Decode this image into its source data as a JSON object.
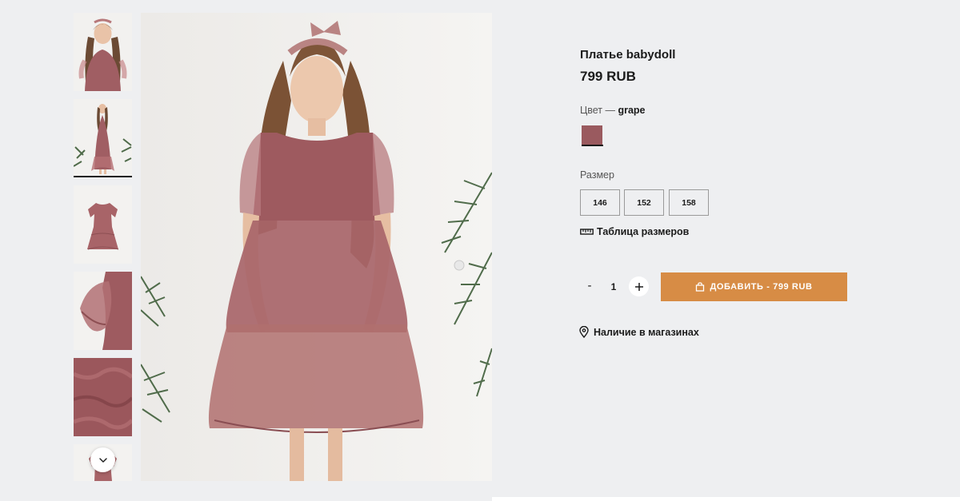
{
  "product": {
    "title": "Платье babydoll",
    "price": "799 RUB"
  },
  "color": {
    "label": "Цвет — ",
    "value": "grape",
    "swatch_hex": "#9a5a5f"
  },
  "sizes": {
    "label": "Размер",
    "options": [
      "146",
      "152",
      "158"
    ]
  },
  "size_chart": {
    "label": "Таблица размеров",
    "icon": "ruler-icon"
  },
  "quantity": {
    "minus_label": "-",
    "value": "1",
    "plus_icon": "plus-icon"
  },
  "add_to_cart": {
    "label": "ДОБАВИТЬ - 799 RUB",
    "icon": "bag-icon",
    "color": "#d78c45"
  },
  "stores": {
    "label": "Наличие в магазинах",
    "icon": "map-pin-icon"
  },
  "gallery": {
    "thumbnail_count": 6,
    "active_thumbnail": 2,
    "scroll_icon": "chevron-down-icon"
  }
}
